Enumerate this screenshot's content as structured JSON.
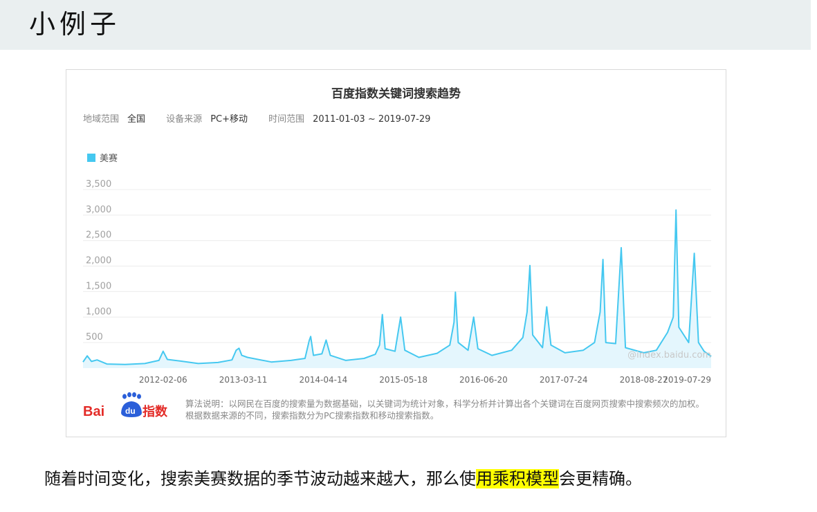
{
  "slide": {
    "title": "小例子"
  },
  "chart_card": {
    "title": "百度指数关键词搜索趋势",
    "meta": {
      "region_label": "地域范围",
      "region_value": "全国",
      "device_label": "设备来源",
      "device_value": "PC+移动",
      "time_label": "时间范围",
      "time_value": "2011-01-03 ~ 2019-07-29"
    },
    "watermark": "@index.baidu.com",
    "note": "算法说明：以网民在百度的搜索量为数据基础，以关键词为统计对象，科学分析并计算出各个关键词在百度网页搜索中搜索频次的加权。根据数据来源的不同，搜索指数分为PC搜索指数和移动搜索指数。",
    "logo_text": {
      "bai": "Bai",
      "du": "du",
      "zhishu": "指数"
    }
  },
  "colors": {
    "series": "#45c8f0",
    "fill": "#e4f6fd",
    "grid": "#ececec",
    "axis_text": "#888888",
    "highlight": "#ffff00"
  },
  "chart_data": {
    "type": "line",
    "title": "百度指数关键词搜索趋势",
    "xlabel": "",
    "ylabel": "",
    "ylim": [
      0,
      3500
    ],
    "yticks": [
      "500",
      "1,000",
      "1,500",
      "2,000",
      "2,500",
      "3,000",
      "3,500"
    ],
    "xticks": [
      "2012-02-06",
      "2013-03-11",
      "2014-04-14",
      "2015-05-18",
      "2016-06-20",
      "2017-07-24",
      "2018-08-27",
      "2019-07-29"
    ],
    "legend_position": "top-left",
    "grid": true,
    "series": [
      {
        "name": "美赛",
        "points": [
          [
            "2011-01-03",
            120
          ],
          [
            "2011-01-24",
            240
          ],
          [
            "2011-02-14",
            130
          ],
          [
            "2011-03-14",
            160
          ],
          [
            "2011-05-02",
            80
          ],
          [
            "2011-08-01",
            70
          ],
          [
            "2011-11-07",
            90
          ],
          [
            "2012-01-16",
            150
          ],
          [
            "2012-02-06",
            330
          ],
          [
            "2012-02-27",
            170
          ],
          [
            "2012-04-30",
            140
          ],
          [
            "2012-07-30",
            90
          ],
          [
            "2012-11-05",
            110
          ],
          [
            "2013-01-14",
            160
          ],
          [
            "2013-02-04",
            350
          ],
          [
            "2013-02-18",
            390
          ],
          [
            "2013-03-04",
            250
          ],
          [
            "2013-04-01",
            210
          ],
          [
            "2013-07-29",
            120
          ],
          [
            "2013-11-04",
            150
          ],
          [
            "2014-01-13",
            190
          ],
          [
            "2014-02-03",
            540
          ],
          [
            "2014-02-10",
            620
          ],
          [
            "2014-02-24",
            250
          ],
          [
            "2014-04-07",
            280
          ],
          [
            "2014-04-28",
            550
          ],
          [
            "2014-05-19",
            250
          ],
          [
            "2014-08-04",
            150
          ],
          [
            "2014-11-03",
            190
          ],
          [
            "2014-12-29",
            270
          ],
          [
            "2015-01-19",
            450
          ],
          [
            "2015-02-02",
            1050
          ],
          [
            "2015-02-16",
            380
          ],
          [
            "2015-04-06",
            330
          ],
          [
            "2015-05-04",
            1000
          ],
          [
            "2015-05-25",
            350
          ],
          [
            "2015-08-03",
            210
          ],
          [
            "2015-11-02",
            290
          ],
          [
            "2016-01-04",
            450
          ],
          [
            "2016-01-25",
            900
          ],
          [
            "2016-02-01",
            1490
          ],
          [
            "2016-02-15",
            500
          ],
          [
            "2016-04-04",
            350
          ],
          [
            "2016-05-02",
            1000
          ],
          [
            "2016-05-23",
            380
          ],
          [
            "2016-08-01",
            250
          ],
          [
            "2016-11-07",
            350
          ],
          [
            "2017-01-02",
            600
          ],
          [
            "2017-01-23",
            1100
          ],
          [
            "2017-02-06",
            2010
          ],
          [
            "2017-02-20",
            650
          ],
          [
            "2017-04-10",
            400
          ],
          [
            "2017-05-01",
            1200
          ],
          [
            "2017-05-22",
            450
          ],
          [
            "2017-07-31",
            300
          ],
          [
            "2017-10-30",
            350
          ],
          [
            "2017-12-25",
            500
          ],
          [
            "2018-01-22",
            1100
          ],
          [
            "2018-02-05",
            2130
          ],
          [
            "2018-02-19",
            500
          ],
          [
            "2018-04-09",
            480
          ],
          [
            "2018-05-07",
            2360
          ],
          [
            "2018-05-28",
            400
          ],
          [
            "2018-08-27",
            300
          ],
          [
            "2018-10-29",
            350
          ],
          [
            "2018-12-24",
            700
          ],
          [
            "2019-01-21",
            1000
          ],
          [
            "2019-02-04",
            3100
          ],
          [
            "2019-02-18",
            800
          ],
          [
            "2019-04-08",
            500
          ],
          [
            "2019-05-06",
            2250
          ],
          [
            "2019-05-27",
            500
          ],
          [
            "2019-06-24",
            330
          ],
          [
            "2019-07-29",
            230
          ]
        ]
      }
    ]
  },
  "caption": {
    "before": "随着时间变化，搜索美赛数据的季节波动越来越大，那么使",
    "highlight": "用乘积模型",
    "after": "会更精确。"
  }
}
